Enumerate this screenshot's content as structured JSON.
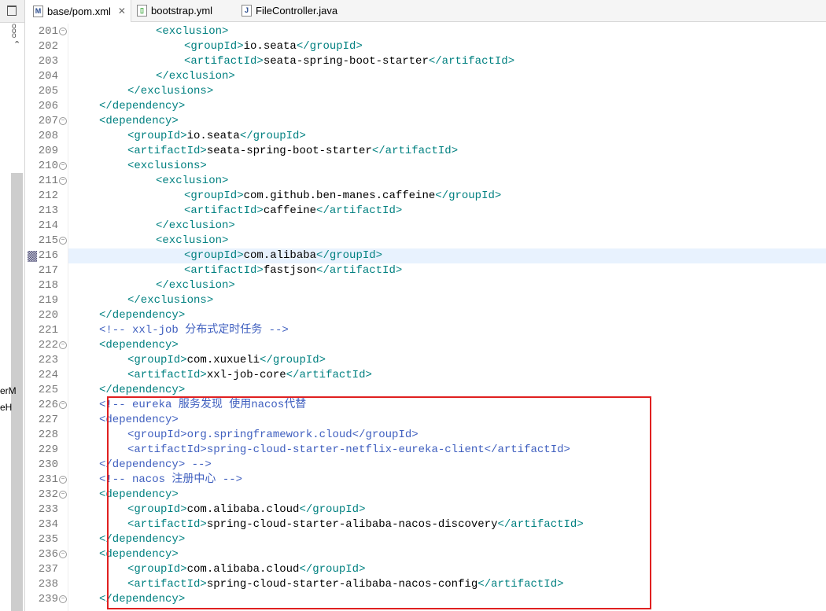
{
  "left_panel": {
    "fragments": [
      "erM",
      "eH"
    ]
  },
  "tabs": [
    {
      "label": "base/pom.xml",
      "icon": "maven-file-icon",
      "active": true,
      "closable": true
    },
    {
      "label": "bootstrap.yml",
      "icon": "yaml-file-icon",
      "active": false
    },
    {
      "label": "FileController.java",
      "icon": "java-file-icon",
      "active": false
    }
  ],
  "editor": {
    "highlighted_line": 216,
    "lines": [
      {
        "n": "201",
        "i": 4,
        "t": "<exclusion>",
        "f": true
      },
      {
        "n": "202",
        "i": 5,
        "t": "<groupId>io.seata</groupId>"
      },
      {
        "n": "203",
        "i": 5,
        "t": "<artifactId>seata-spring-boot-starter</artifactId>"
      },
      {
        "n": "204",
        "i": 4,
        "t": "</exclusion>"
      },
      {
        "n": "205",
        "i": 3,
        "t": "</exclusions>"
      },
      {
        "n": "206",
        "i": 2,
        "t": "</dependency>"
      },
      {
        "n": "207",
        "i": 2,
        "t": "<dependency>",
        "f": true
      },
      {
        "n": "208",
        "i": 3,
        "t": "<groupId>io.seata</groupId>"
      },
      {
        "n": "209",
        "i": 3,
        "t": "<artifactId>seata-spring-boot-starter</artifactId>"
      },
      {
        "n": "210",
        "i": 3,
        "t": "<exclusions>",
        "f": true
      },
      {
        "n": "211",
        "i": 4,
        "t": "<exclusion>",
        "f": true
      },
      {
        "n": "212",
        "i": 5,
        "t": "<groupId>com.github.ben-manes.caffeine</groupId>"
      },
      {
        "n": "213",
        "i": 5,
        "t": "<artifactId>caffeine</artifactId>"
      },
      {
        "n": "214",
        "i": 4,
        "t": "</exclusion>"
      },
      {
        "n": "215",
        "i": 4,
        "t": "<exclusion>",
        "f": true
      },
      {
        "n": "216",
        "i": 5,
        "t": "<groupId>com.alibaba</groupId>"
      },
      {
        "n": "217",
        "i": 5,
        "t": "<artifactId>fastjson</artifactId>"
      },
      {
        "n": "218",
        "i": 4,
        "t": "</exclusion>"
      },
      {
        "n": "219",
        "i": 3,
        "t": "</exclusions>"
      },
      {
        "n": "220",
        "i": 2,
        "t": "</dependency>"
      },
      {
        "n": "221",
        "i": 2,
        "t": "<!-- xxl-job 分布式定时任务 -->",
        "c": true
      },
      {
        "n": "222",
        "i": 2,
        "t": "<dependency>",
        "f": true
      },
      {
        "n": "223",
        "i": 3,
        "t": "<groupId>com.xuxueli</groupId>"
      },
      {
        "n": "224",
        "i": 3,
        "t": "<artifactId>xxl-job-core</artifactId>"
      },
      {
        "n": "225",
        "i": 2,
        "t": "</dependency>"
      },
      {
        "n": "226",
        "i": 2,
        "t": "<!-- eureka 服务发现 使用nacos代替",
        "c": true,
        "f": true
      },
      {
        "n": "227",
        "i": 2,
        "t": "<dependency>",
        "c": true
      },
      {
        "n": "228",
        "i": 3,
        "t": "<groupId>org.springframework.cloud</groupId>",
        "c": true
      },
      {
        "n": "229",
        "i": 3,
        "t": "<artifactId>spring-cloud-starter-netflix-eureka-client</artifactId>",
        "c": true
      },
      {
        "n": "230",
        "i": 2,
        "t": "</dependency> -->",
        "c": true
      },
      {
        "n": "231",
        "i": 2,
        "t": "<!-- nacos 注册中心 -->",
        "c": true,
        "f": true
      },
      {
        "n": "232",
        "i": 2,
        "t": "<dependency>",
        "f": true
      },
      {
        "n": "233",
        "i": 3,
        "t": "<groupId>com.alibaba.cloud</groupId>"
      },
      {
        "n": "234",
        "i": 3,
        "t": "<artifactId>spring-cloud-starter-alibaba-nacos-discovery</artifactId>"
      },
      {
        "n": "235",
        "i": 2,
        "t": "</dependency>"
      },
      {
        "n": "236",
        "i": 2,
        "t": "<dependency>",
        "f": true
      },
      {
        "n": "237",
        "i": 3,
        "t": "<groupId>com.alibaba.cloud</groupId>"
      },
      {
        "n": "238",
        "i": 3,
        "t": "<artifactId>spring-cloud-starter-alibaba-nacos-config</artifactId>"
      },
      {
        "n": "239",
        "i": 2,
        "t": "</dependency>",
        "f": true
      }
    ]
  }
}
